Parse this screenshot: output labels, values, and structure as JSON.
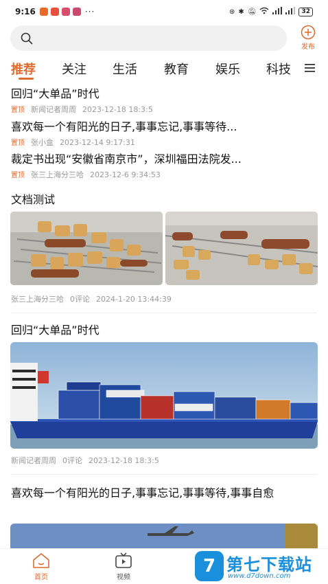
{
  "status_bar": {
    "time": "9:16",
    "more": "···",
    "battery": "32",
    "app_colors": [
      "#e86a2b",
      "#e8503b",
      "#d94d6b",
      "#c94a6a"
    ]
  },
  "search": {
    "placeholder": "",
    "publish_label": "发布"
  },
  "tabs": [
    {
      "label": "推荐",
      "active": true
    },
    {
      "label": "关注"
    },
    {
      "label": "生活"
    },
    {
      "label": "教育"
    },
    {
      "label": "娱乐"
    },
    {
      "label": "科技"
    }
  ],
  "pinned": [
    {
      "title": "回归“大单品”时代",
      "tag": "置顶",
      "author": "新闻记者周周",
      "time": "2023-12-18 18:3:5"
    },
    {
      "title": "喜欢每一个有阳光的日子,事事忘记,事事等待...",
      "tag": "置顶",
      "author": "张小盒",
      "time": "2023-12-14 9:17:31"
    },
    {
      "title": "裁定书出现“安徽省南京市”，深圳福田法院发...",
      "tag": "置顶",
      "author": "张三上海分三哈",
      "time": "2023-12-6 9:34:53"
    }
  ],
  "articles": [
    {
      "title": "文档测试",
      "author": "张三上海分三哈",
      "comments": "0评论",
      "time": "2024-1-20 13:44:39"
    },
    {
      "title": "回归“大单品”时代",
      "author": "新闻记者周周",
      "comments": "0评论",
      "time": "2023-12-18 18:3:5"
    },
    {
      "title": "喜欢每一个有阳光的日子,事事忘记,事事等待,事事自愈"
    }
  ],
  "bottom_nav": [
    {
      "label": "首页",
      "active": true
    },
    {
      "label": "视频"
    }
  ],
  "watermark": {
    "logo_char": "7",
    "name": "第七下载站",
    "url": "www.d7down.com"
  },
  "colors": {
    "accent": "#e06a2e",
    "brand_watermark": "#1a8fdc"
  }
}
